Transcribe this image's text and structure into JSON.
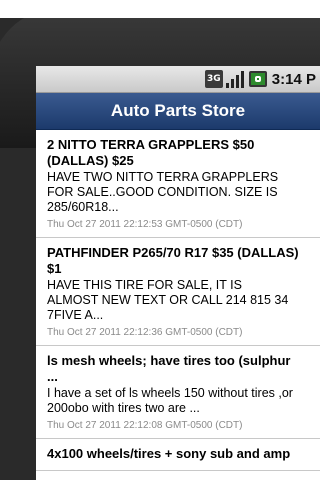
{
  "status_bar": {
    "network": "3G",
    "time": "3:14 P"
  },
  "header": {
    "title": "Auto Parts Store"
  },
  "listings": [
    {
      "title": "2 NITTO TERRA GRAPPLERS $50\n(DALLAS) $25",
      "description": "HAVE TWO NITTO TERRA GRAPPLERS\nFOR SALE..GOOD CONDITION. SIZE IS\n285/60R18...",
      "date": "Thu Oct 27 2011 22:12:53 GMT-0500 (CDT)"
    },
    {
      "title": "PATHFINDER P265/70 R17 $35 (DALLAS)\n$1",
      "description": "HAVE THIS TIRE FOR SALE, IT IS\nALMOST NEW TEXT OR CALL 214 815 34\n7FIVE A...",
      "date": "Thu Oct 27 2011 22:12:36 GMT-0500 (CDT)"
    },
    {
      "title": "ls mesh wheels; have tires too (sulphur\n...",
      "description": "I have a set of ls wheels 150 without tires ,or\n200obo with tires two are ...",
      "date": "Thu Oct 27 2011 22:12:08 GMT-0500 (CDT)"
    },
    {
      "title": "4x100 wheels/tires + sony sub and amp",
      "description": "",
      "date": ""
    }
  ]
}
